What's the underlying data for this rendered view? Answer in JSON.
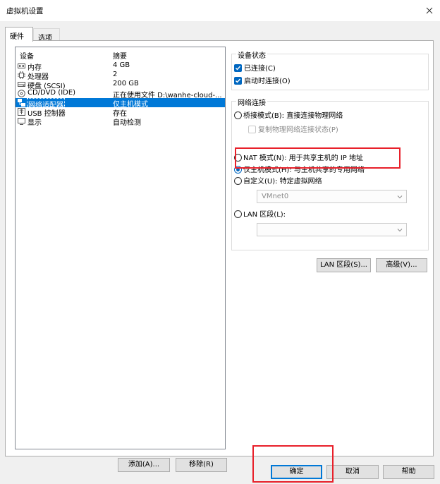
{
  "window": {
    "title": "虚拟机设置"
  },
  "tabs": [
    {
      "label": "硬件"
    },
    {
      "label": "选项"
    }
  ],
  "device_list": {
    "columns": {
      "device": "设备",
      "summary": "摘要"
    },
    "rows": [
      {
        "icon": "memory-icon",
        "name": "内存",
        "summary": "4 GB"
      },
      {
        "icon": "processor-icon",
        "name": "处理器",
        "summary": "2"
      },
      {
        "icon": "hard-disk-icon",
        "name": "硬盘 (SCSI)",
        "summary": "200 GB"
      },
      {
        "icon": "cd-dvd-icon",
        "name": "CD/DVD (IDE)",
        "summary": "正在使用文件 D:\\wanhe-cloud-..."
      },
      {
        "icon": "network-adapter-icon",
        "name": "网络适配器",
        "summary": "仅主机模式",
        "selected": true
      },
      {
        "icon": "usb-icon",
        "name": "USB 控制器",
        "summary": "存在"
      },
      {
        "icon": "display-icon",
        "name": "显示",
        "summary": "自动检测"
      }
    ]
  },
  "list_buttons": {
    "add": "添加(A)...",
    "remove": "移除(R)"
  },
  "device_status": {
    "title": "设备状态",
    "connected": "已连接(C)",
    "connect_at_power_on": "启动时连接(O)"
  },
  "network": {
    "title": "网络连接",
    "bridged": "桥接模式(B): 直接连接物理网络",
    "replicate": "复制物理网络连接状态(P)",
    "nat": "NAT 模式(N): 用于共享主机的 IP 地址",
    "host_only": "仅主机模式(H): 与主机共享的专用网络",
    "custom": "自定义(U): 特定虚拟网络",
    "custom_value": "VMnet0",
    "lan_segment": "LAN 区段(L):",
    "lan_segment_value": "",
    "lan_segments_button": "LAN 区段(S)...",
    "advanced_button": "高级(V)..."
  },
  "dialog_buttons": {
    "ok": "确定",
    "cancel": "取消",
    "help": "帮助"
  },
  "colors": {
    "selection": "#0078d7",
    "highlight_box": "#e8202a",
    "checkbox": "#0067c0"
  }
}
